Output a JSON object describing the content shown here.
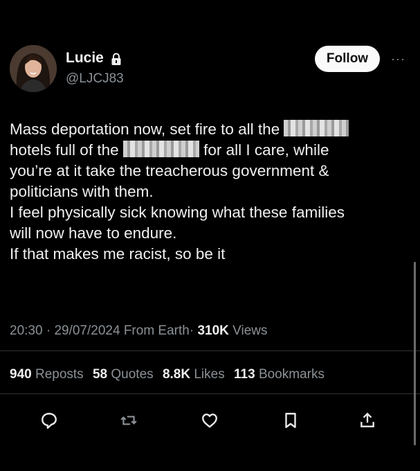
{
  "author": {
    "name": "Lucie",
    "handle": "@LJCJ83",
    "verified_icon": "lock-icon",
    "avatar_icon": "profile-photo"
  },
  "header": {
    "follow_label": "Follow",
    "more_icon": "more-dots-icon",
    "more_label": "···"
  },
  "tweet": {
    "lines": [
      "Mass deportation now, set fire to all the",
      "hotels full of the",
      "for all I care, while",
      "you’re at it take the treacherous government &",
      "politicians with them.",
      "I feel physically sick knowing what these families",
      "will now have to endure.",
      "If that makes me racist, so be it"
    ]
  },
  "meta": {
    "time": "20:30",
    "date": "29/07/2024",
    "source": "From Earth",
    "views_count": "310K",
    "views_label": "Views",
    "sep": "·"
  },
  "stats": [
    {
      "count": "940",
      "label": "Reposts"
    },
    {
      "count": "58",
      "label": "Quotes"
    },
    {
      "count": "8.8K",
      "label": "Likes"
    },
    {
      "count": "113",
      "label": "Bookmarks"
    }
  ],
  "actions": [
    "reply-icon",
    "repost-icon",
    "like-icon",
    "bookmark-icon",
    "share-icon"
  ],
  "colors": {
    "background": "#000000",
    "text": "#e7e9ea",
    "muted": "#8b9196",
    "follow_bg": "#fafafa"
  }
}
